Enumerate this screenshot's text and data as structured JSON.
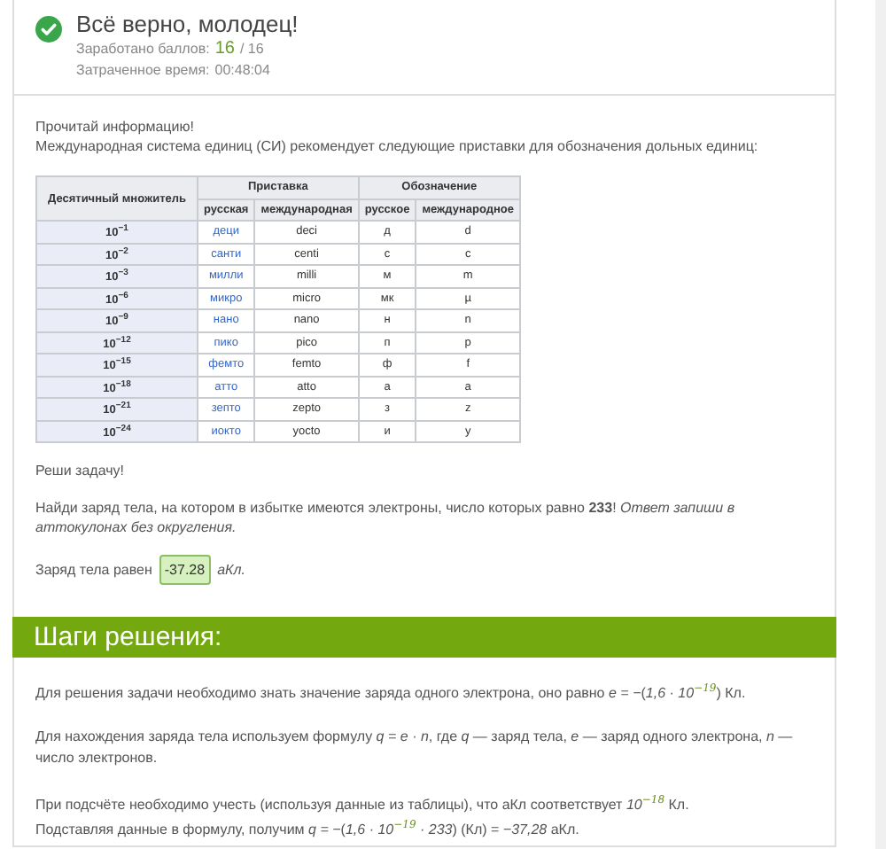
{
  "result": {
    "title": "Всё верно, молодец!",
    "score_label": "Заработано баллов:",
    "score": "16",
    "score_total": "/ 16",
    "time_label": "Затраченное время:",
    "time": "00:48:04"
  },
  "info": {
    "lines": [
      "Прочитай информацию!",
      "Международная система единиц (СИ) рекомендует следующие приставки для обозначения дольных единиц:"
    ]
  },
  "table": {
    "multiplier_heading": "Десятичный множитель",
    "prefix_heading": "Приставка",
    "symbol_heading": "Обозначение",
    "subheadings": [
      "русская",
      "международная",
      "русское",
      "международное"
    ],
    "rows": [
      {
        "multiplier": "10$^{−1}$",
        "ru": "деци",
        "intl": "deci",
        "ru_symbol": "д",
        "intl_symbol": "d"
      },
      {
        "multiplier": "10$^{−2}$",
        "ru": "санти",
        "intl": "centi",
        "ru_symbol": "с",
        "intl_symbol": "c"
      },
      {
        "multiplier": "10$^{−3}$",
        "ru": "милли",
        "intl": "milli",
        "ru_symbol": "м",
        "intl_symbol": "m"
      },
      {
        "multiplier": "10$^{−6}$",
        "ru": "микро",
        "intl": "micro",
        "ru_symbol": "мк",
        "intl_symbol": "µ"
      },
      {
        "multiplier": "10$^{−9}$",
        "ru": "нано",
        "intl": "nano",
        "ru_symbol": "н",
        "intl_symbol": "n"
      },
      {
        "multiplier": "10$^{−12}$",
        "ru": "пико",
        "intl": "pico",
        "ru_symbol": "п",
        "intl_symbol": "p"
      },
      {
        "multiplier": "10$^{−15}$",
        "ru": "фемто",
        "intl": "femto",
        "ru_symbol": "ф",
        "intl_symbol": "f"
      },
      {
        "multiplier": "10$^{−18}$",
        "ru": "атто",
        "intl": "atto",
        "ru_symbol": "а",
        "intl_symbol": "a"
      },
      {
        "multiplier": "10$^{−21}$",
        "ru": "зепто",
        "intl": "zepto",
        "ru_symbol": "з",
        "intl_symbol": "z"
      },
      {
        "multiplier": "10$^{−24}$",
        "ru": "иокто",
        "intl": "yocto",
        "ru_symbol": "и",
        "intl_symbol": "y"
      }
    ]
  },
  "task": {
    "heading": "Реши задачу!",
    "question": "Найди заряд тела, на котором в избытке имеются электроны, число которых равно **233**! *Ответ запиши в аттокулонах без округления.*",
    "answer_label": "Заряд тела равен",
    "answer": "-37.28",
    "unit": "аКл."
  },
  "solution": {
    "title": "Шаги решения:",
    "paragraphs": [
      [
        "Для решения задачи необходимо знать значение заряда одного электрона, оно равно *e* *=* *−*(*1,6 · 10*$^{−19}$) Кл."
      ],
      [
        "Для нахождения заряда тела используем формулу *q* *=* *e · n*, где *q* — заряд тела, *e* — заряд одного электрона, *n* — число электронов."
      ],
      [
        "При подсчёте необходимо учесть (используя данные из таблицы), что аКл соответствует *10*$^{−18}$ Кл.",
        "Подставляя данные в формулу, получим *q* *=* *−*(*1,6 · 10*$^{−19}$ *· 233*) (Кл) = *−37,28* аКл."
      ]
    ]
  }
}
